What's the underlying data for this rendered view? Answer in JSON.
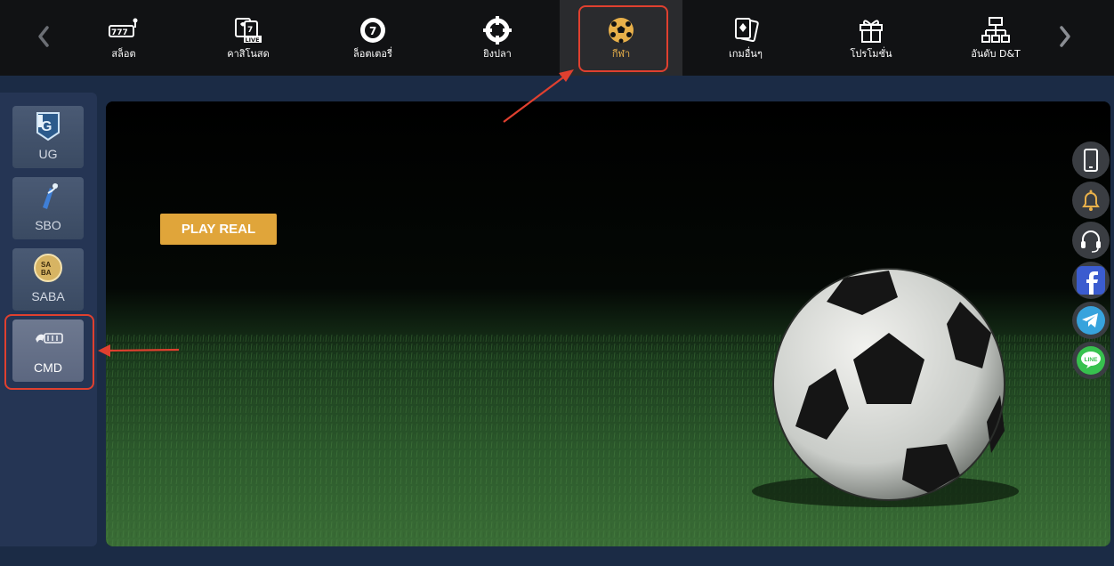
{
  "topnav": {
    "items": [
      {
        "label": "สล็อต",
        "icon": "slot-machine-icon"
      },
      {
        "label": "คาสิโนสด",
        "icon": "live-casino-icon"
      },
      {
        "label": "ล็อตเตอรี่",
        "icon": "lottery-ball-icon"
      },
      {
        "label": "ยิงปลา",
        "icon": "crosshair-icon"
      },
      {
        "label": "กีฬา",
        "icon": "soccer-ball-icon"
      },
      {
        "label": "เกมอื่นๆ",
        "icon": "playing-cards-icon"
      },
      {
        "label": "โปรโมชั่น",
        "icon": "gift-icon"
      },
      {
        "label": "อันดับ D&T",
        "icon": "hierarchy-icon"
      }
    ],
    "active_index": 4,
    "prev_icon": "chevron-left-icon",
    "next_icon": "chevron-right-icon"
  },
  "sidebar": {
    "providers": [
      {
        "label": "UG",
        "icon": "ug-logo-icon"
      },
      {
        "label": "SBO",
        "icon": "sbo-logo-icon"
      },
      {
        "label": "SABA",
        "icon": "saba-logo-icon"
      },
      {
        "label": "CMD",
        "icon": "cmd-logo-icon"
      }
    ],
    "active_index": 3
  },
  "banner": {
    "play_button_label": "PLAY REAL",
    "image": "soccer-ball-on-grass"
  },
  "floating_icons": [
    {
      "icon": "mobile-phone-icon"
    },
    {
      "icon": "bell-icon"
    },
    {
      "icon": "headset-icon"
    },
    {
      "icon": "facebook-icon"
    },
    {
      "icon": "telegram-icon"
    },
    {
      "icon": "line-icon",
      "text": "LINE"
    }
  ],
  "colors": {
    "accent": "#e8b04a",
    "play_button": "#e0a53a",
    "highlight_box": "#e0402f",
    "background": "#1b2b45",
    "nav_background": "#111214"
  }
}
